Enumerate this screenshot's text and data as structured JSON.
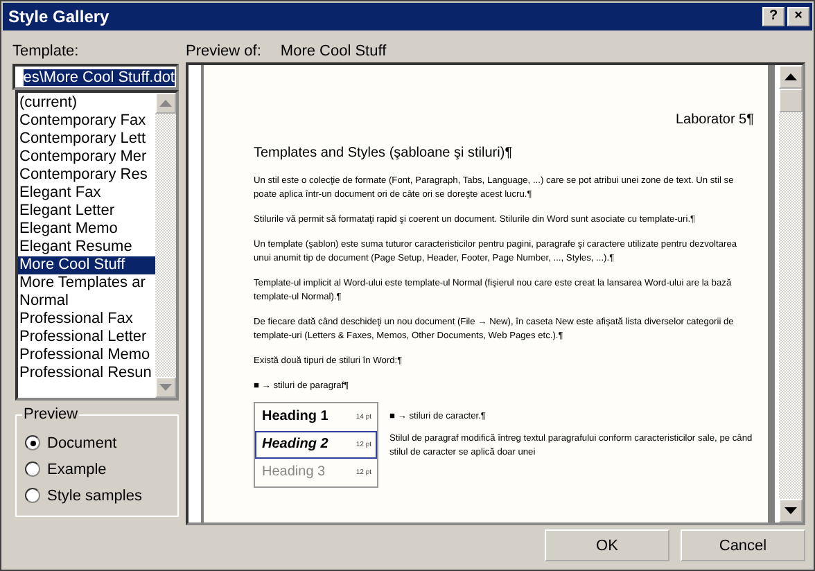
{
  "window": {
    "title": "Style Gallery",
    "buttons": [
      "?",
      "×"
    ]
  },
  "template": {
    "label": "Template:",
    "value": "es\\More Cool Stuff.dot",
    "items": [
      {
        "label": "(current)",
        "selected": false
      },
      {
        "label": "Contemporary Fax",
        "selected": false
      },
      {
        "label": "Contemporary Lett",
        "selected": false
      },
      {
        "label": "Contemporary Mer",
        "selected": false
      },
      {
        "label": "Contemporary Res",
        "selected": false
      },
      {
        "label": "Elegant Fax",
        "selected": false
      },
      {
        "label": "Elegant Letter",
        "selected": false
      },
      {
        "label": "Elegant Memo",
        "selected": false
      },
      {
        "label": "Elegant Resume",
        "selected": false
      },
      {
        "label": "More Cool Stuff",
        "selected": true
      },
      {
        "label": "More Templates ar",
        "selected": false
      },
      {
        "label": "Normal",
        "selected": false
      },
      {
        "label": "Professional Fax",
        "selected": false
      },
      {
        "label": "Professional Letter",
        "selected": false
      },
      {
        "label": "Professional Memo",
        "selected": false
      },
      {
        "label": "Professional Resun",
        "selected": false
      }
    ]
  },
  "preview_options": {
    "title": "Preview",
    "options": [
      {
        "label": "Document",
        "selected": true
      },
      {
        "label": "Example",
        "selected": false
      },
      {
        "label": "Style samples",
        "selected": false
      }
    ]
  },
  "preview": {
    "label": "Preview of:",
    "name": "More Cool Stuff",
    "blocks": [
      {
        "kind": "header",
        "text": "Laborator 5¶"
      },
      {
        "kind": "title",
        "text": "Templates and Styles (şabloane şi stiluri)¶"
      },
      {
        "kind": "para",
        "text": "Un stil este o colecţie de formate (Font, Paragraph, Tabs, Language, ...) care se pot atribui unei zone de text. Un stil se poate aplica într-un document ori de câte ori se doreşte acest lucru.¶"
      },
      {
        "kind": "para",
        "text": "Stilurile vă permit să formataţi rapid şi coerent un document. Stilurile din Word sunt asociate cu template-uri.¶"
      },
      {
        "kind": "para",
        "text": "Un template (şablon) este suma tuturor caracteristicilor pentru pagini, paragrafe şi caractere utilizate pentru dezvoltarea unui anumit tip de document (Page Setup, Header, Footer, Page Number, ..., Styles, ...).¶"
      },
      {
        "kind": "para",
        "text": "Template-ul implicit al Word-ului este template-ul Normal (fişierul nou care este creat la lansarea Word-ului are la bază template-ul Normal).¶"
      },
      {
        "kind": "para",
        "text": "De fiecare dată când deschideţi un nou document (File → New), în caseta New este afişată lista diverselor categorii de template-uri (Letters & Faxes, Memos, Other Documents, Web Pages etc.).¶"
      },
      {
        "kind": "para",
        "text": "Există două tipuri de stiluri în Word:¶"
      },
      {
        "kind": "bullet",
        "text": "■ → stiluri de paragraf¶"
      }
    ],
    "styles": [
      {
        "name": "Heading 1",
        "size": "14 pt",
        "selected": false
      },
      {
        "name": "Heading 2",
        "size": "12 pt",
        "selected": true
      },
      {
        "name": "Heading 3",
        "size": "12 pt",
        "selected": false
      }
    ],
    "side_blocks": [
      {
        "kind": "bullet",
        "text": "■ → stiluri de caracter.¶"
      },
      {
        "kind": "para",
        "text": "Stilul de paragraf modifică întreg textul paragrafului conform caracteristicilor sale, pe când stilul de caracter se aplică doar unei"
      }
    ]
  },
  "buttons": [
    "OK",
    "Cancel"
  ]
}
